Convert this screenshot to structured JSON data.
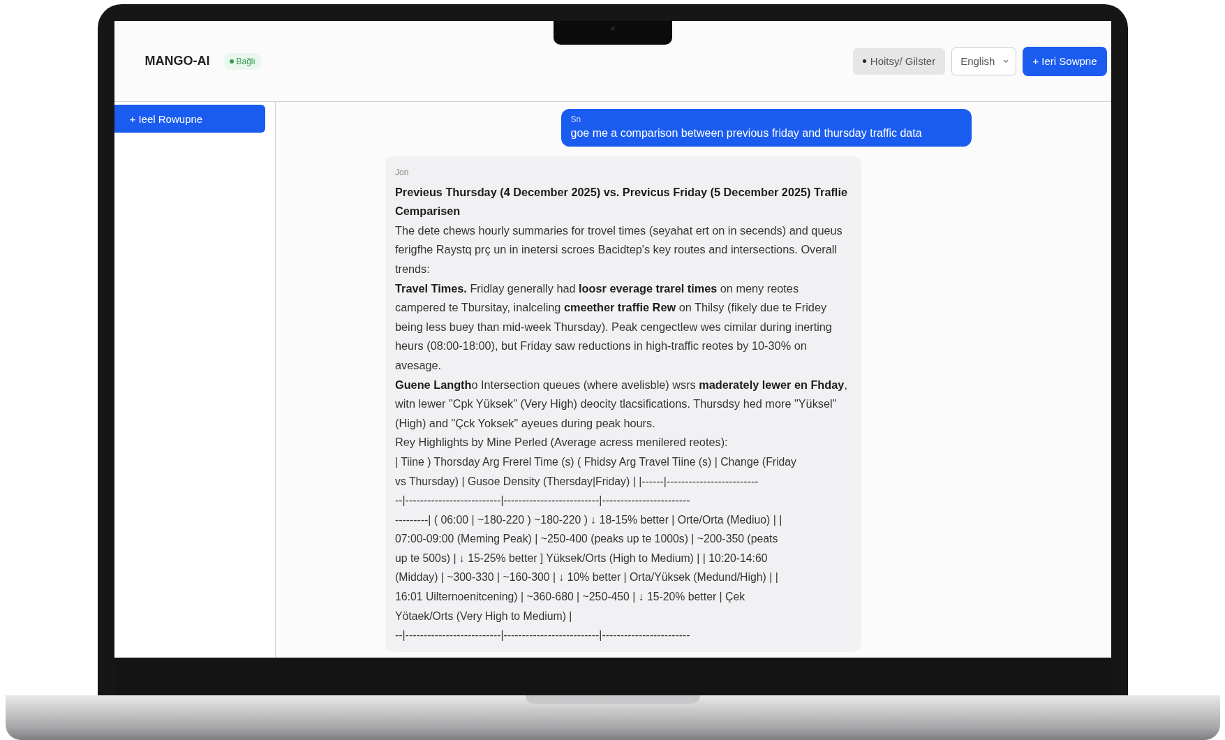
{
  "header": {
    "logo": "MANGO-AI",
    "status_badge": "Bağlı",
    "history_button": "Hoitsy/ Gilster",
    "language_select": {
      "value": "English"
    },
    "new_chat_button": "+ Ieri Sowpne"
  },
  "sidebar": {
    "new_chat_button": "+ Ieel Rowupne"
  },
  "messages": [
    {
      "kind": "user",
      "sender": "Sn",
      "text": "goe me a comparison between previous friday and thursday traffic data"
    },
    {
      "kind": "assistant",
      "sender": "Jon",
      "blocks": [
        {
          "kind": "heading",
          "text": "Previeus Thursday (4 December 2025) vs. Previcus Friday (5 December 2025) Traflie Cemparisen"
        },
        {
          "kind": "paragraph",
          "text": "The dete chews hourly summaries for trovel times (seyahat ert on in secends) and queus ferigfhe Raystq prç un in inetersi scroes Bacidtep's key routes and intersections. Overall trends:"
        },
        {
          "kind": "paragraph",
          "text": "**Travel Times.** Fridlay generally had **loosr everage trarel times** on meny reotes campered te Tbursitay, inalceling **cmeether traffie Rew** on Thilsy (fikely due te Fridey being less buey than mid-week Thursday). Peak cengectlew wes cimilar during inerting heurs (08:00-18:00), but Friday saw reductions in high-traffic reotes by 10-30% on avesage."
        },
        {
          "kind": "paragraph",
          "text": "**Guene Langth**o Intersection queues (where avelisble) wsrs **maderately lewer en Fhday**, witn lewer \"Cpk Yüksek\" (Very High) deocity tlacsifications. Thursdsy hed more \"Yüksel\" (High) and \"Çck Yoksek\" ayeues during peak hours."
        },
        {
          "kind": "paragraph",
          "text": "Rey Highlights by Mine Perled (Average acress menilered reotes):"
        },
        {
          "kind": "raw",
          "lines": [
            "| Tiine ) Thorsday Arg Frerel Time (s) ( Fhidsy Arg Travel Tiine (s) | Change (Friday",
            "vs Thursday) | Gusoe Density (Thersday|Friday) | |------|-------------------------",
            "--|--------------------------|--------------------------|------------------------",
            "---------| ( 06:00 | ~180-220 ) ~180-220 ) ↓ 18-15% better | Orte/Orta (Mediuo) | |",
            "07:00-09:00 (Meming Peak) | ~250-400 (peaks up te 1000s) | ~200-350 (peats",
            "up te 500s) | ↓ 15-25% better ] Yüksek/Orts (High to Medium) | | 10:20-14:60",
            "(Midday) | ~300-330 | ~160-300 | ↓ 10% better | Orta/Yüksek (Medund/High) | |",
            "16:01 Uilternoenitcening) | ~360-680 | ~250-450 | ↓ 15-20% better | Çek",
            "Yötaek/Orts (Very High to Medium) |",
            "--|--------------------------|--------------------------|------------------------"
          ]
        }
      ]
    }
  ]
}
